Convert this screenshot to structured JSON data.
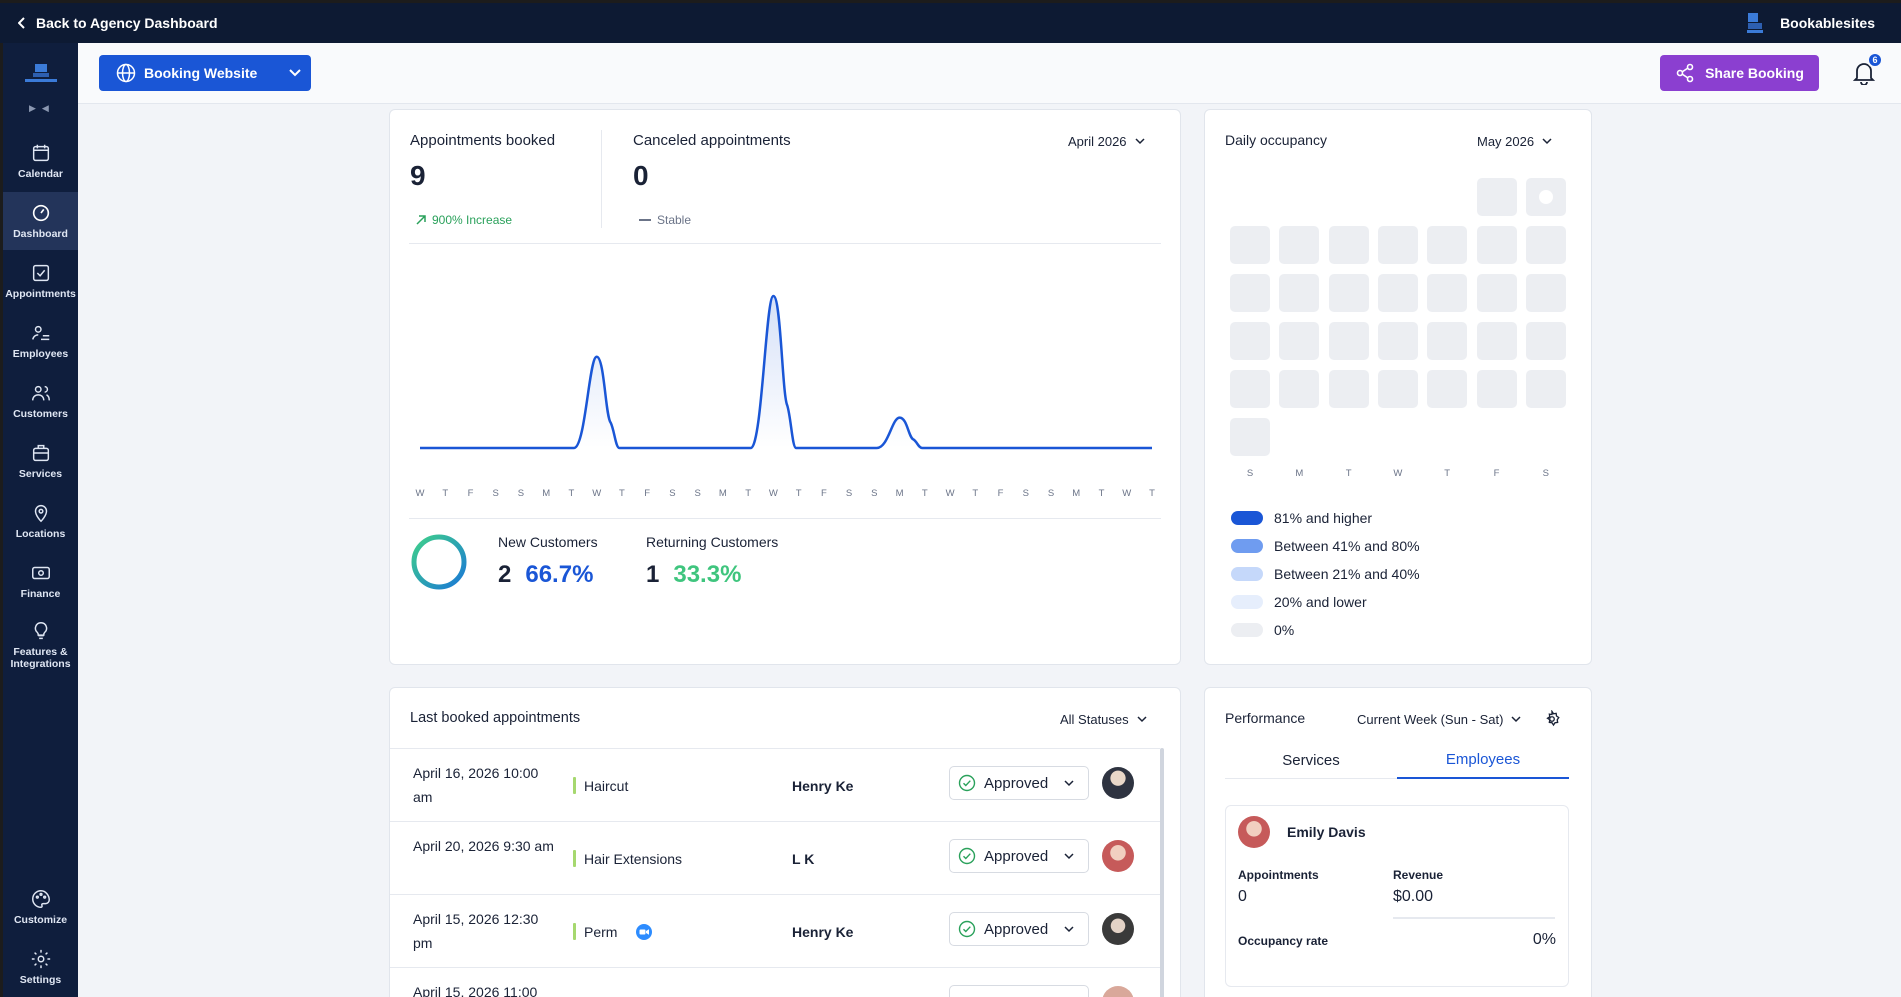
{
  "topbar": {
    "back_label": "Back to Agency Dashboard",
    "brand_name": "Bookablesites"
  },
  "sidebar": {
    "items": [
      {
        "label": "Calendar",
        "icon": "calendar-icon"
      },
      {
        "label": "Dashboard",
        "icon": "dashboard-icon",
        "active": true
      },
      {
        "label": "Appointments",
        "icon": "appointments-icon"
      },
      {
        "label": "Employees",
        "icon": "employees-icon"
      },
      {
        "label": "Customers",
        "icon": "customers-icon"
      },
      {
        "label": "Services",
        "icon": "services-icon"
      },
      {
        "label": "Locations",
        "icon": "location-pin-icon"
      },
      {
        "label": "Finance",
        "icon": "finance-icon"
      },
      {
        "label": "Features & Integrations",
        "icon": "lightbulb-icon"
      },
      {
        "label": "Customize",
        "icon": "palette-icon"
      },
      {
        "label": "Settings",
        "icon": "gear-icon"
      }
    ]
  },
  "header": {
    "booking_label": "Booking Website",
    "share_label": "Share Booking",
    "notifications_count": "6"
  },
  "stats": {
    "booked_label": "Appointments booked",
    "booked_value": "9",
    "booked_trend": "900% Increase",
    "canceled_label": "Canceled appointments",
    "canceled_value": "0",
    "canceled_trend": "Stable",
    "month": "April 2026",
    "new_label": "New Customers",
    "new_count": "2",
    "new_pct": "66.7%",
    "ret_label": "Returning Customers",
    "ret_count": "1",
    "ret_pct": "33.3%"
  },
  "chart_data": {
    "type": "line",
    "x": [
      "W",
      "T",
      "F",
      "S",
      "S",
      "M",
      "T",
      "W",
      "T",
      "F",
      "S",
      "S",
      "M",
      "T",
      "W",
      "T",
      "F",
      "S",
      "S",
      "M",
      "T",
      "W",
      "T",
      "F",
      "S",
      "S",
      "M",
      "T",
      "W",
      "T"
    ],
    "values": [
      0,
      0,
      0,
      0,
      0,
      0,
      0,
      3,
      0,
      0,
      0,
      0,
      0,
      0,
      5,
      0,
      0,
      0,
      0,
      1,
      0,
      0,
      0,
      0,
      0,
      0,
      0,
      0,
      0,
      0
    ],
    "title": "",
    "xlabel": "",
    "ylabel": "",
    "color": "#1a56d6"
  },
  "occupancy": {
    "title": "Daily occupancy",
    "month": "May 2026",
    "days": [
      "S",
      "M",
      "T",
      "W",
      "T",
      "F",
      "S"
    ],
    "legend": [
      {
        "label": "81% and higher",
        "color": "#1a56d6"
      },
      {
        "label": "Between 41% and 80%",
        "color": "#6f9cf0"
      },
      {
        "label": "Between 21% and 40%",
        "color": "#c5d8fa"
      },
      {
        "label": "20% and lower",
        "color": "#e6eefc"
      },
      {
        "label": "0%",
        "color": "#eceef2"
      }
    ]
  },
  "appointments": {
    "title": "Last booked appointments",
    "filter": "All Statuses",
    "rows": [
      {
        "date": "April 16, 2026 10:00 am",
        "service": "Haircut",
        "customer": "Henry Ke",
        "status": "Approved"
      },
      {
        "date": "April 20, 2026 9:30 am",
        "service": "Hair Extensions",
        "customer": "L K",
        "status": "Approved"
      },
      {
        "date": "April 15, 2026 12:30 pm",
        "service": "Perm",
        "customer": "Henry Ke",
        "status": "Approved"
      },
      {
        "date": "April 15, 2026 11:00",
        "service": "",
        "customer": "",
        "status": ""
      }
    ]
  },
  "performance": {
    "title": "Performance",
    "period": "Current Week (Sun - Sat)",
    "tabs": [
      "Services",
      "Employees"
    ],
    "employee": {
      "name": "Emily Davis",
      "appointments_label": "Appointments",
      "appointments": "0",
      "revenue_label": "Revenue",
      "revenue": "$0.00",
      "occupancy_label": "Occupancy rate",
      "occupancy": "0%"
    }
  }
}
